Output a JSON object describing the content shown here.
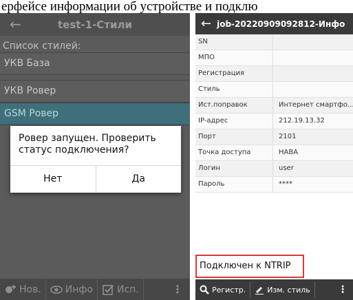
{
  "caption": "ерфейсе информации об устройстве и подклю",
  "left": {
    "title": "test-1-Стили",
    "list_label": "Список стилей:",
    "items": [
      "УКВ База",
      "УКВ Ровер",
      "GSM Ровер"
    ],
    "dialog": {
      "message": "Ровер запущен. Проверить статус подключения?",
      "no": "Нет",
      "yes": "Да"
    },
    "bottom": {
      "new": "Нов.",
      "info": "Инфо",
      "use": "Исп."
    }
  },
  "right": {
    "title": "job-20220909092812-Инфо",
    "rows": [
      {
        "k": "SN",
        "v": ""
      },
      {
        "k": "МПО",
        "v": ""
      },
      {
        "k": "Регистрация",
        "v": ""
      },
      {
        "k": "Стиль",
        "v": ""
      },
      {
        "k": "Ист.поправок",
        "v": "Интернет смартфо..."
      },
      {
        "k": "IP-адрес",
        "v": "212.19.13.32"
      },
      {
        "k": "Порт",
        "v": "2101"
      },
      {
        "k": "Точка доступа",
        "v": "HABA"
      },
      {
        "k": "Логин",
        "v": "user"
      },
      {
        "k": "Пароль",
        "v": "****"
      }
    ],
    "status": "Подключен к NTRIP",
    "bottom": {
      "register": "Регистр.",
      "edit_style": "Изм. стиль"
    }
  }
}
